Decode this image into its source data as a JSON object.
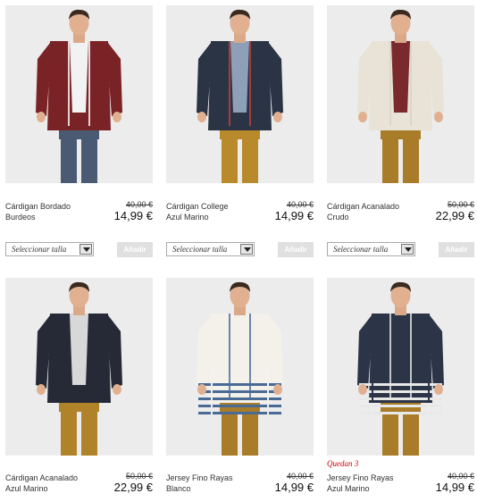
{
  "products": [
    {
      "name_line1": "Cárdigan Bordado",
      "name_line2": "Burdeos",
      "old_price": "40,00 €",
      "price": "14,99 €",
      "badge": "",
      "select_placeholder": "Seleccionar talla",
      "add_label": "Añadir",
      "image": {
        "sweater": "#7a2326",
        "shirt": "#f2f2f2",
        "pants": "#4a5a72",
        "trim": "#ffffff"
      }
    },
    {
      "name_line1": "Cárdigan College",
      "name_line2": "Azul Marino",
      "old_price": "40,00 €",
      "price": "14,99 €",
      "badge": "",
      "select_placeholder": "Seleccionar talla",
      "add_label": "Añadir",
      "image": {
        "sweater": "#2b3444",
        "shirt": "#8ea0b8",
        "pants": "#b88a2c",
        "trim": "#c04040"
      }
    },
    {
      "name_line1": "Cárdigan Acanalado",
      "name_line2": "Crudo",
      "old_price": "50,00 €",
      "price": "22,99 €",
      "badge": "",
      "select_placeholder": "Seleccionar talla",
      "add_label": "Añadir",
      "image": {
        "sweater": "#e8e3d6",
        "shirt": "#7a2a2e",
        "pants": "#a87c28",
        "trim": "#d8d2c2"
      }
    },
    {
      "name_line1": "Cárdigan Acanalado",
      "name_line2": "Azul Marino",
      "old_price": "50,00 €",
      "price": "22,99 €",
      "badge": "",
      "select_placeholder": "",
      "add_label": "",
      "image": {
        "sweater": "#252a36",
        "shirt": "#d8d8d8",
        "pants": "#b08229",
        "trim": "#252a36"
      }
    },
    {
      "name_line1": "Jersey Fino Rayas",
      "name_line2": "Blanco",
      "old_price": "40,00 €",
      "price": "14,99 €",
      "badge": "",
      "select_placeholder": "",
      "add_label": "",
      "image": {
        "sweater": "#f4f1ea",
        "shirt": "#f4f1ea",
        "pants": "#a87c28",
        "trim": "#4a6a96"
      }
    },
    {
      "name_line1": "Jersey Fino Rayas",
      "name_line2": "Azul Marino",
      "old_price": "40,00 €",
      "price": "14,99 €",
      "badge": "Quedan 3",
      "select_placeholder": "",
      "add_label": "",
      "image": {
        "sweater": "#2c3447",
        "shirt": "#2c3447",
        "pants": "#a87c28",
        "trim": "#e8e8e8"
      }
    }
  ]
}
